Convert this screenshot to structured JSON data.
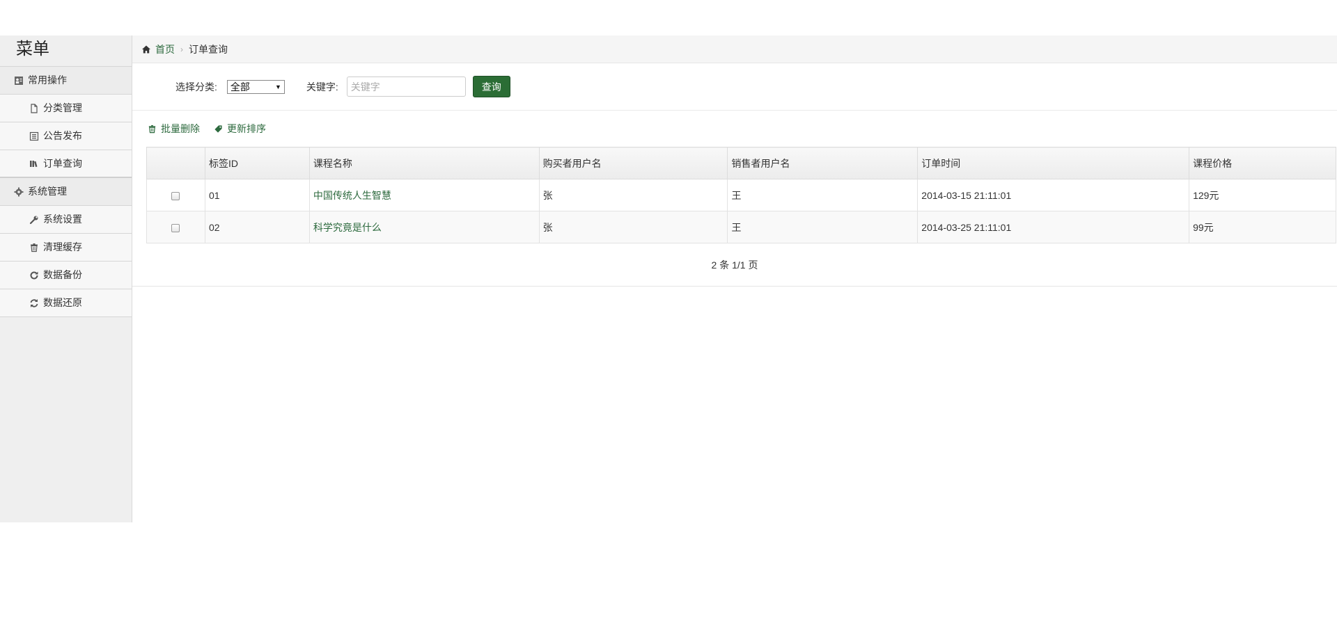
{
  "sidebar": {
    "title": "菜单",
    "groups": [
      {
        "label": "常用操作",
        "icon": "user-card-icon",
        "items": [
          {
            "label": "分类管理",
            "icon": "file-icon"
          },
          {
            "label": "公告发布",
            "icon": "list-box-icon"
          },
          {
            "label": "订单查询",
            "icon": "books-icon"
          }
        ]
      },
      {
        "label": "系统管理",
        "icon": "gear-icon",
        "items": [
          {
            "label": "系统设置",
            "icon": "wrench-icon"
          },
          {
            "label": "清理缓存",
            "icon": "trash-icon"
          },
          {
            "label": "数据备份",
            "icon": "refresh-icon"
          },
          {
            "label": "数据还原",
            "icon": "sync-icon"
          }
        ]
      }
    ]
  },
  "breadcrumb": {
    "home": "首页",
    "current": "订单查询"
  },
  "filter": {
    "category_label": "选择分类:",
    "category_value": "全部",
    "keyword_label": "关键字:",
    "keyword_placeholder": "关键字",
    "keyword_value": "",
    "query_button": "查询"
  },
  "actions": {
    "batch_delete": "批量删除",
    "update_sort": "更新排序"
  },
  "table": {
    "headers": [
      "",
      "标签ID",
      "课程名称",
      "购买者用户名",
      "销售者用户名",
      "订单时间",
      "课程价格"
    ],
    "rows": [
      {
        "id": "01",
        "course": "中国传统人生智慧",
        "buyer": "张",
        "seller": "王",
        "time": "2014-03-15 21:11:01",
        "price": "129元"
      },
      {
        "id": "02",
        "course": "科学究竟是什么",
        "buyer": "张",
        "seller": "王",
        "time": "2014-03-25 21:11:01",
        "price": "99元"
      }
    ]
  },
  "pager": {
    "text": "2 条 1/1 页"
  },
  "colors": {
    "accent": "#2b6d35",
    "link": "#2d6a3e",
    "sidebar_bg": "#efefef"
  }
}
